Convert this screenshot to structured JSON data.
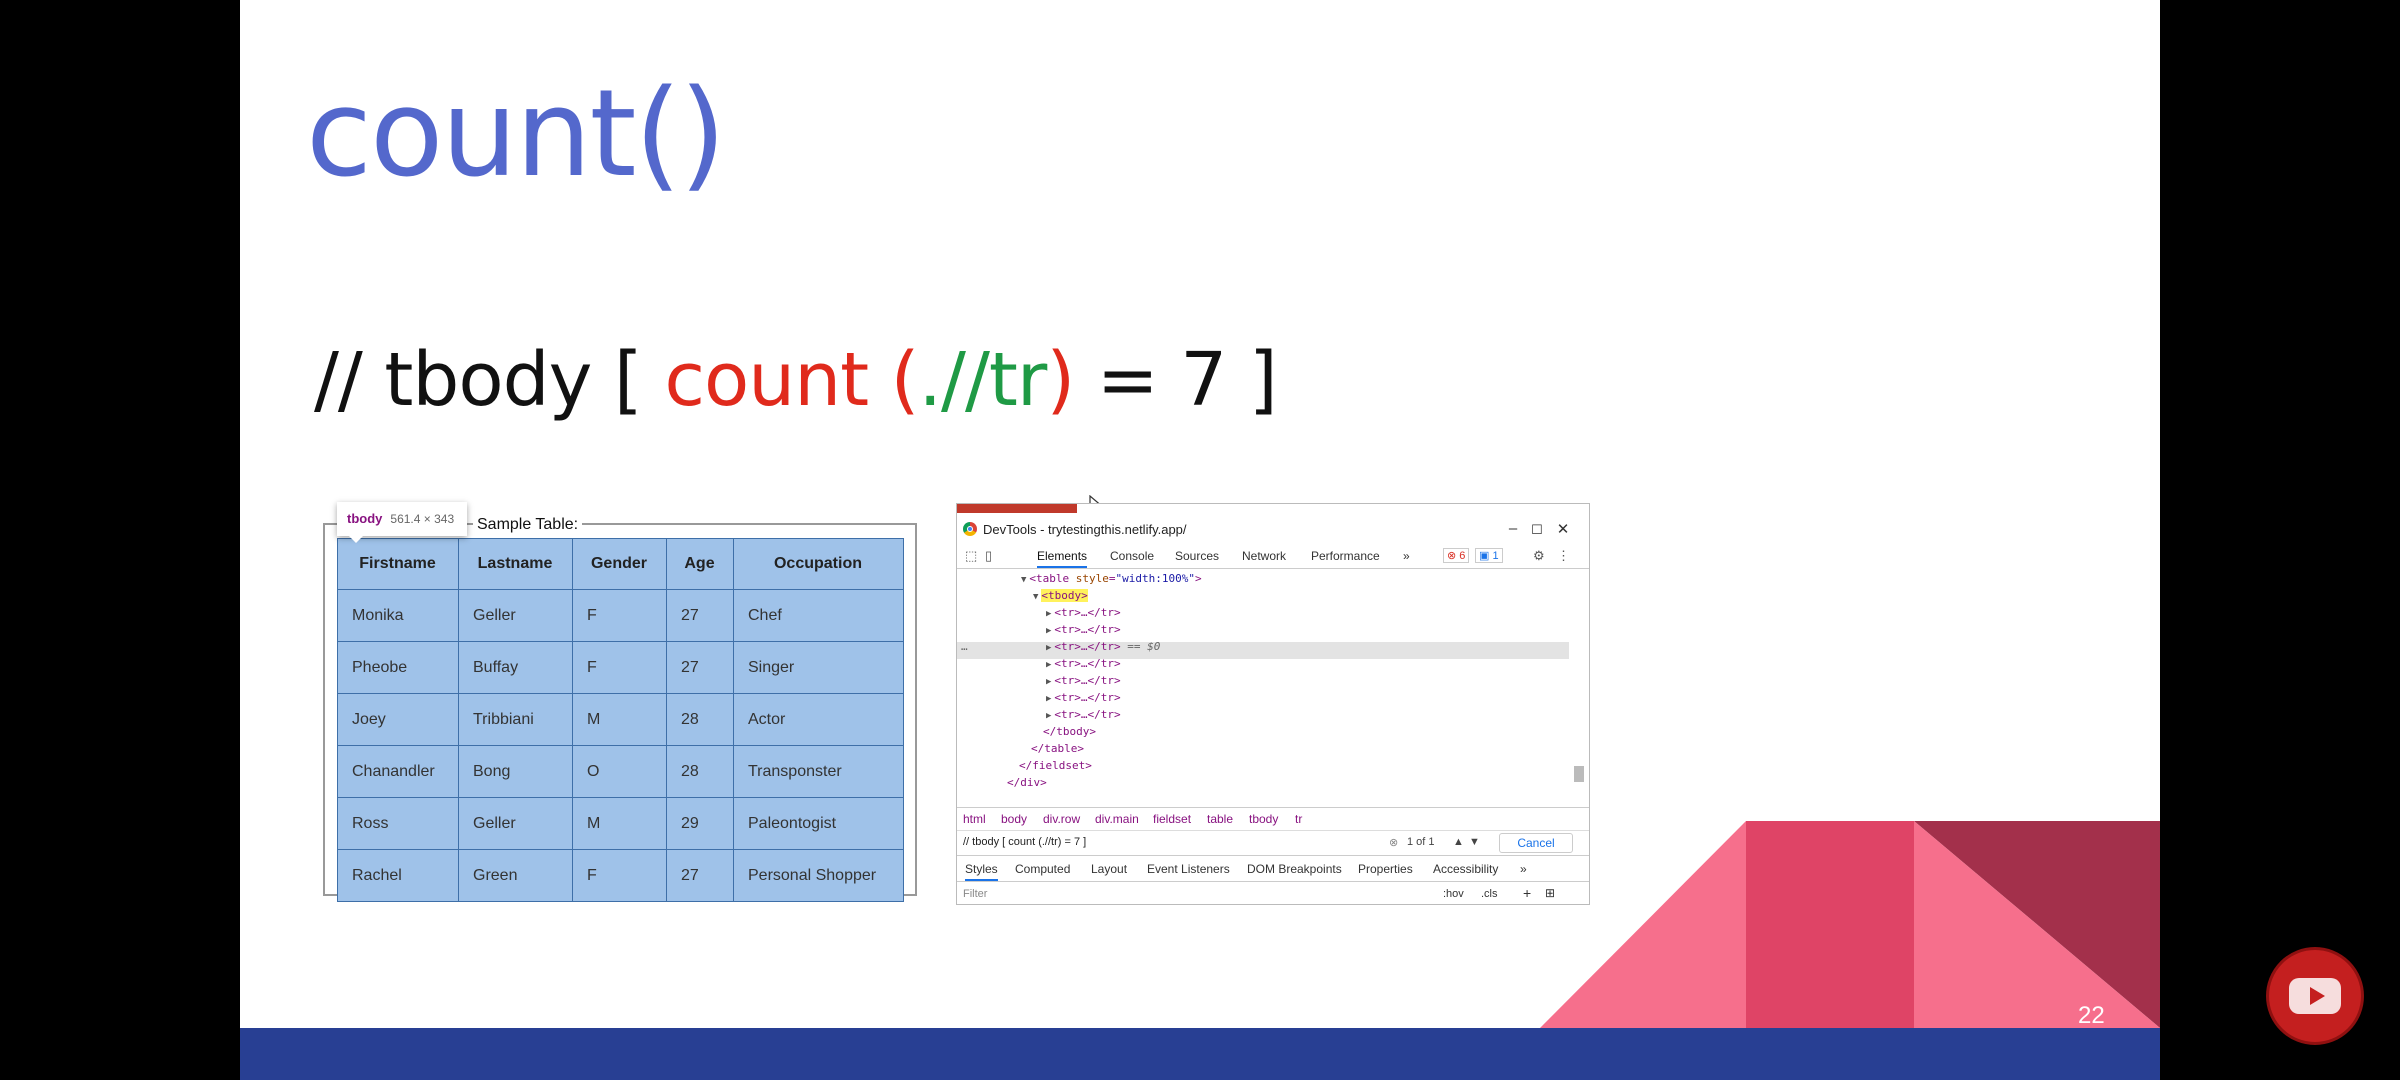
{
  "slide": {
    "title": "count()",
    "xpath": {
      "prefix": "// tbody [ ",
      "func": "count",
      "paren_open": " (",
      "arg": ".//tr",
      "paren_close": ")",
      "suffix": " = 7 ]"
    },
    "page_number": "22"
  },
  "tooltip": {
    "tag": "tbody",
    "dims": "561.4 × 343"
  },
  "legend": "Sample Table:",
  "table": {
    "headers": [
      "Firstname",
      "Lastname",
      "Gender",
      "Age",
      "Occupation"
    ],
    "rows": [
      [
        "Monika",
        "Geller",
        "F",
        "27",
        "Chef"
      ],
      [
        "Pheobe",
        "Buffay",
        "F",
        "27",
        "Singer"
      ],
      [
        "Joey",
        "Tribbiani",
        "M",
        "28",
        "Actor"
      ],
      [
        "Chanandler",
        "Bong",
        "O",
        "28",
        "Transponster"
      ],
      [
        "Ross",
        "Geller",
        "M",
        "29",
        "Paleontogist"
      ],
      [
        "Rachel",
        "Green",
        "F",
        "27",
        "Personal Shopper"
      ]
    ]
  },
  "devtools": {
    "window_title": "DevTools - trytestingthis.netlify.app/",
    "tabs": [
      "Elements",
      "Console",
      "Sources",
      "Network",
      "Performance"
    ],
    "more": "»",
    "errors": "6",
    "messages": "1",
    "dom": {
      "table_tag": "<table",
      "table_attr": "style",
      "table_val": "\"width:100%\"",
      "tbody_open": "<tbody>",
      "tr": "<tr>…</tr>",
      "selected_suffix": "== $0",
      "tbody_close": "</tbody>",
      "table_close": "</table>",
      "fieldset_close": "</fieldset>",
      "div_close": "</div>",
      "ellipsis": "…"
    },
    "breadcrumbs": [
      "html",
      "body",
      "div.row",
      "div.main",
      "fieldset",
      "table",
      "tbody",
      "tr"
    ],
    "search": {
      "query": "// tbody [ count (.//tr) = 7 ]",
      "matches": "1 of 1",
      "cancel": "Cancel"
    },
    "panel_tabs": [
      "Styles",
      "Computed",
      "Layout",
      "Event Listeners",
      "DOM Breakpoints",
      "Properties",
      "Accessibility"
    ],
    "filter_placeholder": "Filter",
    "hov": ":hov",
    "cls": ".cls"
  },
  "colors": {
    "title": "#5468cc",
    "red": "#e02a1c",
    "green": "#1f9a45",
    "table_bg": "#9fc2e9",
    "bottom_bar": "#283f93",
    "pink": "#f66f8c",
    "crimson": "#df4466",
    "maroon": "#a3304b"
  }
}
